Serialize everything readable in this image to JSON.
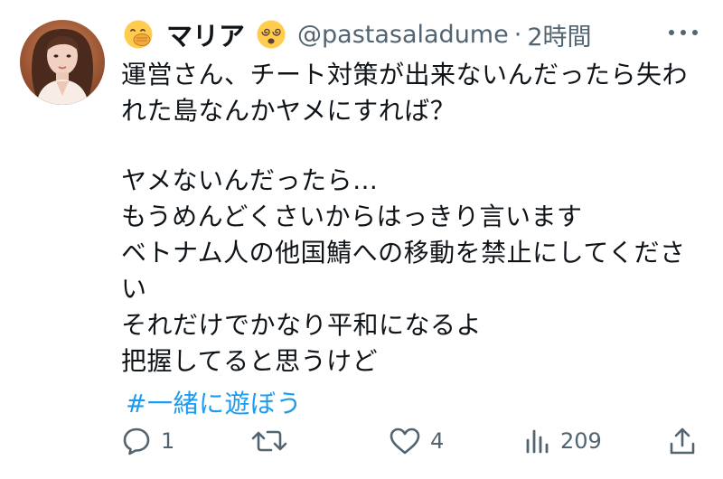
{
  "tweet": {
    "display_name": "マリア",
    "handle": "@pastasaladume",
    "separator": "·",
    "time": "2時間",
    "lines": [
      "運営さん、チート対策が出来ないんだったら失わ",
      "れた島なんかヤメにすれば？",
      "ヤメないんだったら…",
      "もうめんどくさいからはっきり言います",
      "ベトナム人の他国鯖への移動を禁止にしてくださ",
      "い",
      "それだけでかなり平和になるよ",
      "把握してると思うけど"
    ],
    "hashtag": "#一緒に遊ぼう"
  },
  "actions": {
    "replies": "1",
    "retweets": "",
    "likes": "4",
    "views": "209"
  },
  "icons": {
    "left_name_emoji": "face-with-hand-over-mouth-emoji",
    "right_name_emoji": "dizzy-face-emoji",
    "more": "more-icon",
    "reply": "reply-icon",
    "retweet": "retweet-icon",
    "like": "heart-icon",
    "views": "views-icon",
    "share": "share-icon"
  },
  "colors": {
    "text": "#0f1419",
    "secondary": "#536471",
    "hashtag": "#1d9bf0",
    "background": "#ffffff"
  }
}
